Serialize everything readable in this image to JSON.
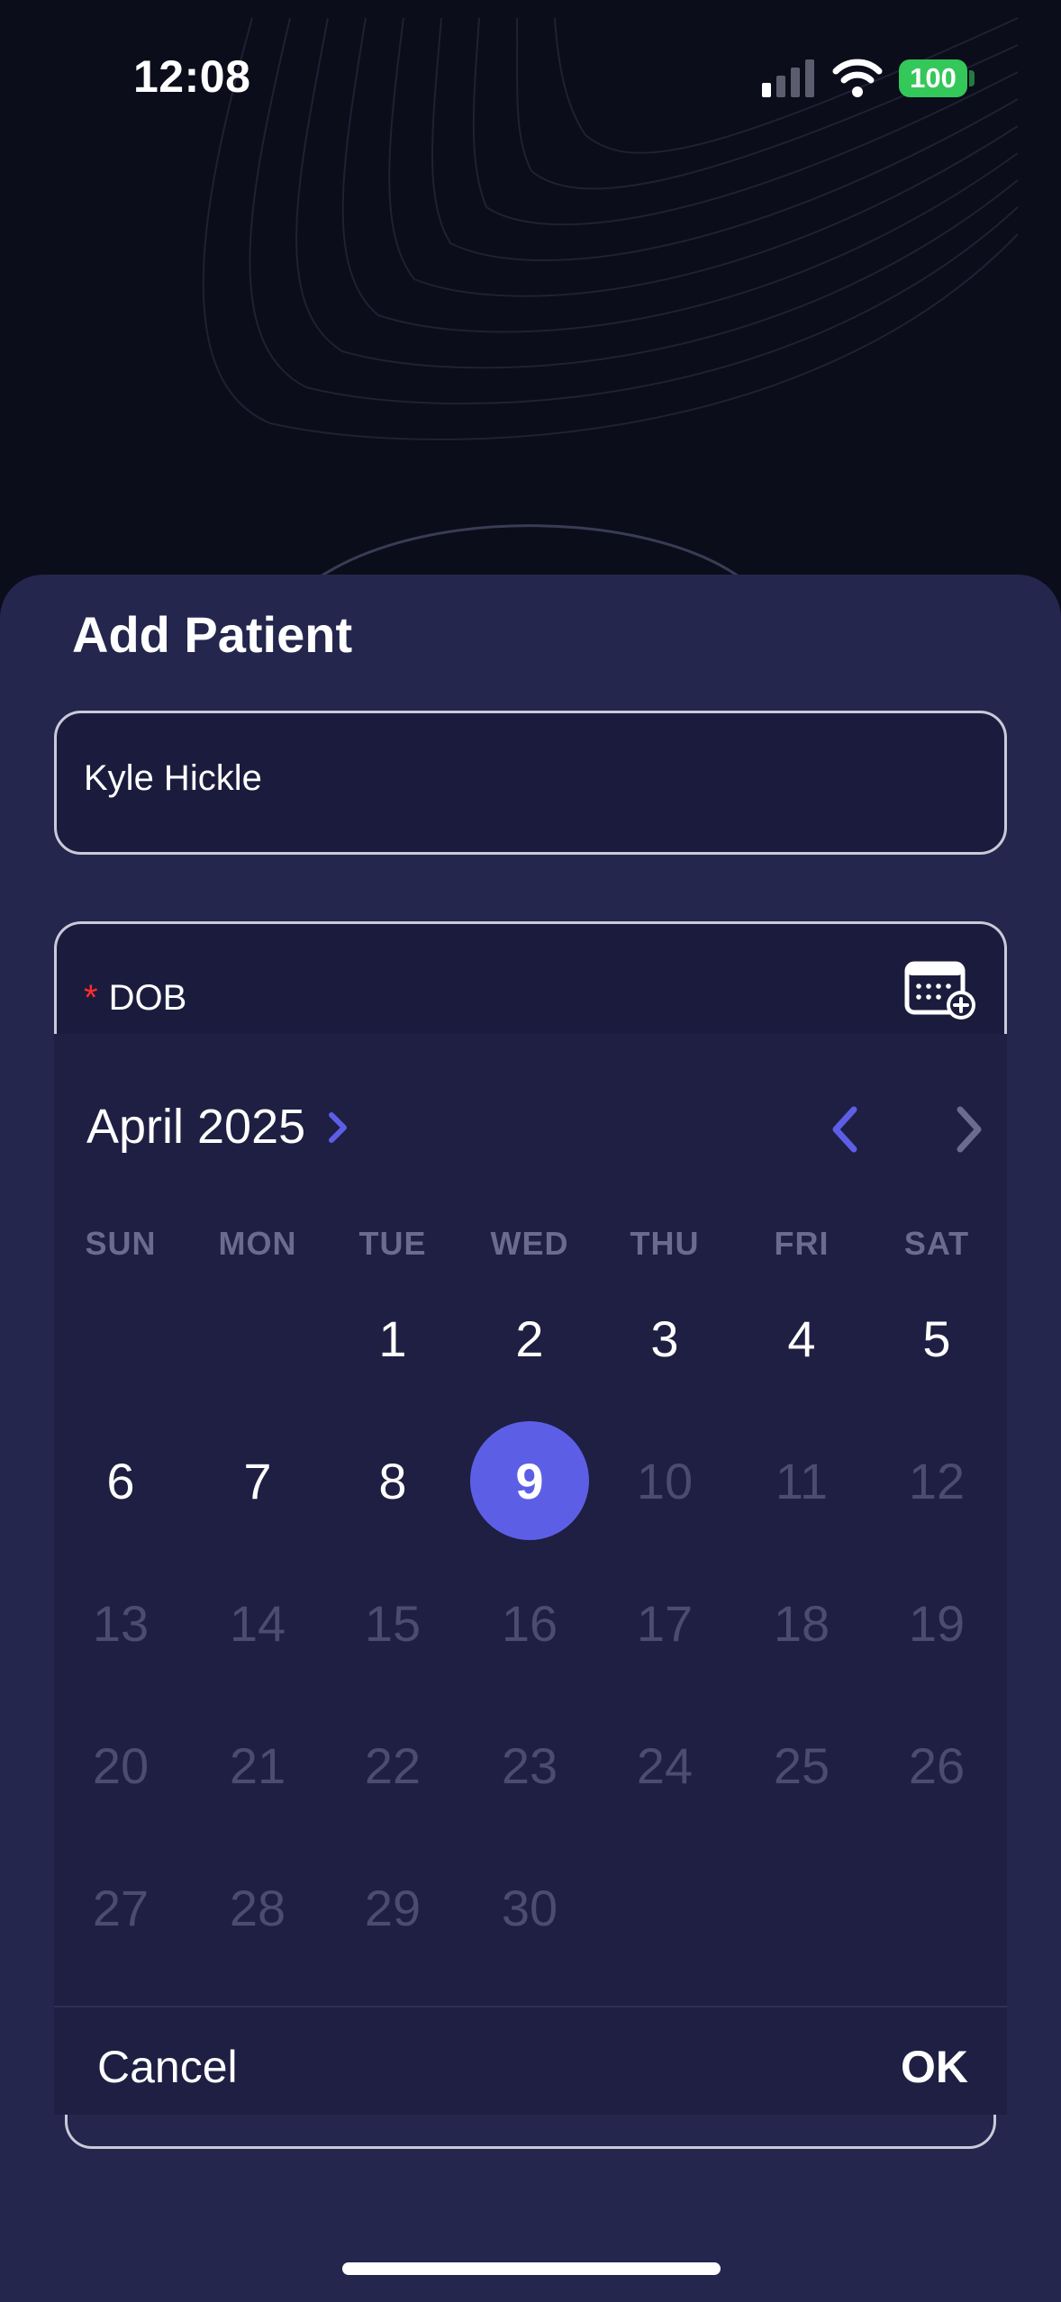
{
  "status_bar": {
    "time": "12:08",
    "battery": "100",
    "battery_color": "#34c759"
  },
  "sheet": {
    "title": "Add Patient",
    "name_field_value": "Kyle Hickle",
    "dob_required_marker": "*",
    "dob_label": "DOB",
    "calendar_icon": "calendar-add-icon"
  },
  "picker": {
    "month_label": "April 2025",
    "weekdays": [
      "SUN",
      "MON",
      "TUE",
      "WED",
      "THU",
      "FRI",
      "SAT"
    ],
    "days": [
      "1",
      "2",
      "3",
      "4",
      "5",
      "6",
      "7",
      "8",
      "9",
      "10",
      "11",
      "12",
      "13",
      "14",
      "15",
      "16",
      "17",
      "18",
      "19",
      "20",
      "21",
      "22",
      "23",
      "24",
      "25",
      "26",
      "27",
      "28",
      "29",
      "30"
    ],
    "selected_day": "9",
    "last_enabled_day": "9",
    "accent_color": "#5c5fe6",
    "cancel_label": "Cancel",
    "ok_label": "OK"
  }
}
